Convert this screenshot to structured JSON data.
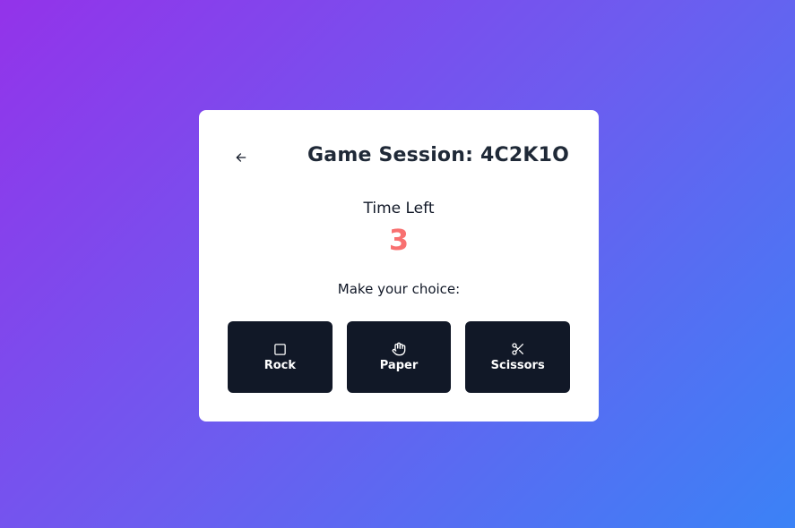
{
  "header": {
    "back_icon": "arrow-left-icon",
    "title": "Game Session: 4C2K1O"
  },
  "timer": {
    "label": "Time Left",
    "value": "3",
    "value_color": "#f87171"
  },
  "prompt": "Make your choice:",
  "choices": [
    {
      "label": "Rock",
      "icon": "square-icon"
    },
    {
      "label": "Paper",
      "icon": "hand-icon"
    },
    {
      "label": "Scissors",
      "icon": "scissors-icon"
    }
  ],
  "colors": {
    "background_start": "#9333ea",
    "background_end": "#3b82f6",
    "card": "#ffffff",
    "button": "#111827"
  }
}
